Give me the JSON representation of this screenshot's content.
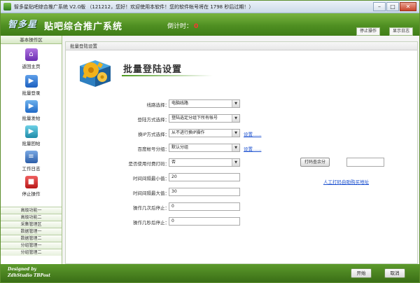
{
  "window": {
    "title": "智多星贴吧综合推广系统 V2.0版 （121212，您好！欢迎使用本软件！您的软件帐号将在 1798 秒后过期！）",
    "controls": [
      "–",
      "□",
      "✕"
    ]
  },
  "banner": {
    "logo": "智多星",
    "app_name": "贴吧综合推广系统",
    "countdown_label": "倒计时：",
    "countdown_value": "0",
    "stop_button": "停止操作",
    "show_log_button": "显示日志"
  },
  "sidebar": {
    "header": "基本操作区",
    "items": [
      {
        "label": "返回主页",
        "icon": "home-icon"
      },
      {
        "label": "批量登录",
        "icon": "play-icon"
      },
      {
        "label": "批量发帖",
        "icon": "play-icon"
      },
      {
        "label": "批量回帖",
        "icon": "play-icon"
      },
      {
        "label": "工作日志",
        "icon": "document-icon"
      },
      {
        "label": "停止操作",
        "icon": "stop-icon"
      }
    ],
    "groups": [
      "高级功能一",
      "高级功能二",
      "采集管理区",
      "数据管理一",
      "数据管理二",
      "分组管理一",
      "分组管理二"
    ]
  },
  "main": {
    "tab": "批量登陆设置",
    "heading": "批量登陆设置",
    "fields": {
      "route": {
        "label": "线路选择：",
        "value": "电脑线路"
      },
      "login_mode": {
        "label": "登陆方式选择：",
        "value": "登陆选定分组下所有帐号"
      },
      "ip_mode": {
        "label": "换IP方式选择：",
        "value": "从不进行换IP操作"
      },
      "account_group": {
        "label": "百度帐号分组：",
        "value": "默认分组"
      },
      "captcha": {
        "label": "是否使用付费打码：",
        "value": "否"
      },
      "min_interval": {
        "label": "时间间隔最小值：",
        "value": "20"
      },
      "max_interval": {
        "label": "时间间隔最大值：",
        "value": "30"
      },
      "stop_after_ops": {
        "label": "操作几次后停止：",
        "value": "0"
      },
      "stop_after_secs": {
        "label": "操作几秒后停止：",
        "value": "0"
      }
    },
    "settings_link": "设置......",
    "query_points_button": "打码查余分",
    "manual_captcha_link": "人工打码自助购买地址"
  },
  "footer": {
    "designed_by": "Designed by",
    "studio": "ZdhStudio  TBPost",
    "start_button": "开始",
    "cancel_button": "取消"
  },
  "colors": {
    "banner_green": "#4f8f22",
    "link_blue": "#1a4fcf",
    "countdown_red": "#ff3333"
  }
}
